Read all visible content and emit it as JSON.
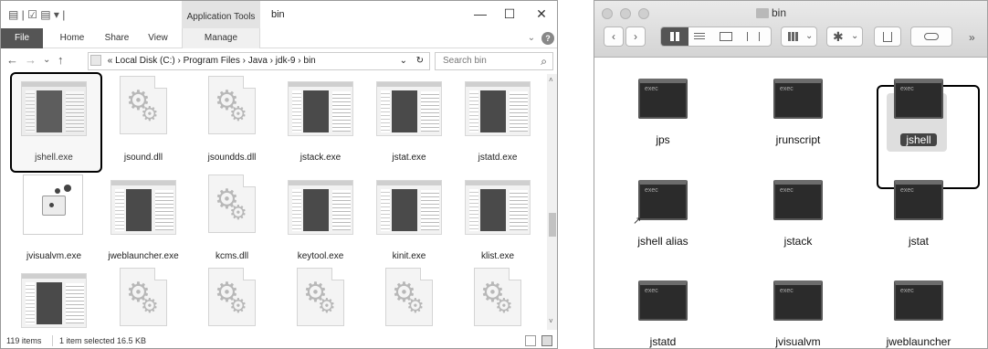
{
  "windows": {
    "quick_access_glyph": "▤ | ☑ ▤ ▾ |",
    "app_tools": "Application Tools",
    "window_title": "bin",
    "controls": {
      "minimize": "—",
      "maximize": "☐",
      "close": "✕"
    },
    "ribbon_tabs": [
      "File",
      "Home",
      "Share",
      "View",
      "Manage"
    ],
    "ribbon_chevron": "⌄",
    "help_icon": "?",
    "nav": {
      "back": "←",
      "forward": "→",
      "history": "⌄",
      "up": "↑"
    },
    "address": {
      "overflow": "«",
      "crumbs": [
        "Local Disk (C:)",
        "Program Files",
        "Java",
        "jdk-9",
        "bin"
      ],
      "sep": "›",
      "dropdown": "⌄",
      "refresh": "↻"
    },
    "search": {
      "placeholder": "Search bin",
      "icon": "⌕"
    },
    "files": [
      {
        "name": "jshell.exe",
        "type": "exe",
        "selected": true
      },
      {
        "name": "jsound.dll",
        "type": "dll"
      },
      {
        "name": "jsoundds.dll",
        "type": "dll"
      },
      {
        "name": "jstack.exe",
        "type": "exe"
      },
      {
        "name": "jstat.exe",
        "type": "exe"
      },
      {
        "name": "jstatd.exe",
        "type": "exe"
      },
      {
        "name": "jvisualvm.exe",
        "type": "vvm"
      },
      {
        "name": "jweblauncher.exe",
        "type": "exe"
      },
      {
        "name": "kcms.dll",
        "type": "dll"
      },
      {
        "name": "keytool.exe",
        "type": "exe"
      },
      {
        "name": "kinit.exe",
        "type": "exe"
      },
      {
        "name": "klist.exe",
        "type": "exe"
      },
      {
        "name": "",
        "type": "exe"
      },
      {
        "name": "",
        "type": "dll"
      },
      {
        "name": "",
        "type": "dll"
      },
      {
        "name": "",
        "type": "dll"
      },
      {
        "name": "",
        "type": "dll"
      },
      {
        "name": "",
        "type": "dll"
      }
    ],
    "status": {
      "count": "119 items",
      "selection": "1 item selected  16.5 KB"
    }
  },
  "mac": {
    "title": "bin",
    "toolbar": {
      "back": "‹",
      "forward": "›",
      "overflow": "»"
    },
    "exec_label": "exec",
    "items": [
      {
        "name": "jps"
      },
      {
        "name": "jrunscript"
      },
      {
        "name": "jshell",
        "selected": true
      },
      {
        "name": "jshell alias",
        "alias": true
      },
      {
        "name": "jstack"
      },
      {
        "name": "jstat"
      },
      {
        "name": "jstatd"
      },
      {
        "name": "jvisualvm"
      },
      {
        "name": "jweblauncher"
      }
    ]
  }
}
